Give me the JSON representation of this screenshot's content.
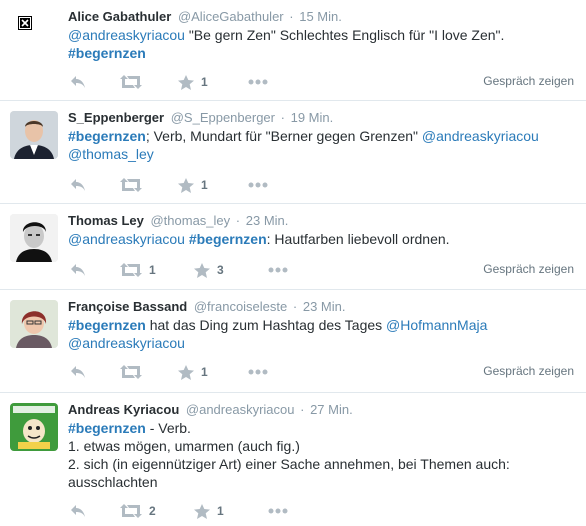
{
  "tweets": [
    {
      "fullname": "Alice Gabathuler",
      "username": "@AliceGabathuler",
      "time": "15 Min.",
      "text": [
        {
          "t": "mention",
          "v": "@andreaskyriacou"
        },
        {
          "t": "text",
          "v": " \"Be gern Zen\" Schlechtes Englisch für \"I love Zen\"."
        },
        {
          "t": "br"
        },
        {
          "t": "hashtag",
          "v": "#begernzen"
        }
      ],
      "retweets": "",
      "favorites": "1",
      "conversation": "Gespräch zeigen"
    },
    {
      "fullname": "S_Eppenberger",
      "username": "@S_Eppenberger",
      "time": "19 Min.",
      "text": [
        {
          "t": "hashtag",
          "v": "#begernzen"
        },
        {
          "t": "text",
          "v": "; Verb, Mundart für \"Berner gegen Grenzen\" "
        },
        {
          "t": "mention",
          "v": "@andreaskyriacou"
        },
        {
          "t": "text",
          "v": " "
        },
        {
          "t": "mention",
          "v": "@thomas_ley"
        }
      ],
      "retweets": "",
      "favorites": "1",
      "conversation": ""
    },
    {
      "fullname": "Thomas Ley",
      "username": "@thomas_ley",
      "time": "23 Min.",
      "text": [
        {
          "t": "mention",
          "v": "@andreaskyriacou"
        },
        {
          "t": "text",
          "v": " "
        },
        {
          "t": "hashtag",
          "v": "#begernzen"
        },
        {
          "t": "text",
          "v": ": Hautfarben liebevoll ordnen."
        }
      ],
      "retweets": "1",
      "favorites": "3",
      "conversation": "Gespräch zeigen"
    },
    {
      "fullname": "Françoise Bassand",
      "username": "@francoiseleste",
      "time": "23 Min.",
      "text": [
        {
          "t": "hashtag",
          "v": "#begernzen"
        },
        {
          "t": "text",
          "v": " hat das Ding zum Hashtag des Tages "
        },
        {
          "t": "mention",
          "v": "@HofmannMaja"
        },
        {
          "t": "text",
          "v": " "
        },
        {
          "t": "mention",
          "v": "@andreaskyriacou"
        }
      ],
      "retweets": "",
      "favorites": "1",
      "conversation": "Gespräch zeigen"
    },
    {
      "fullname": "Andreas Kyriacou",
      "username": "@andreaskyriacou",
      "time": "27 Min.",
      "text": [
        {
          "t": "hashtag",
          "v": "#begernzen"
        },
        {
          "t": "text",
          "v": " - Verb."
        },
        {
          "t": "br"
        },
        {
          "t": "text",
          "v": "1. etwas mögen, umarmen (auch fig.)"
        },
        {
          "t": "br"
        },
        {
          "t": "text",
          "v": "2. sich (in eigennütziger Art) einer Sache annehmen, bei Themen auch: ausschlachten"
        }
      ],
      "retweets": "2",
      "favorites": "1",
      "conversation": ""
    }
  ],
  "colors": {
    "link": "#2b7bb9",
    "icon": "#b1bbc3",
    "meta": "#8899a6"
  },
  "icons": [
    "reply-icon",
    "retweet-icon",
    "favorite-icon",
    "more-icon"
  ]
}
